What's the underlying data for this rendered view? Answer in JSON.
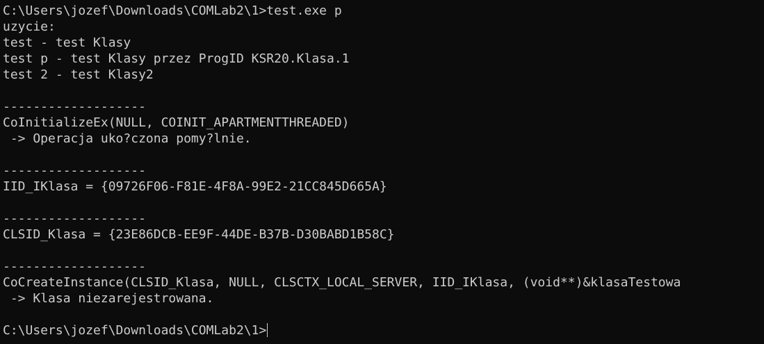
{
  "terminal": {
    "lines": [
      "C:\\Users\\jozef\\Downloads\\COMLab2\\1>test.exe p",
      "uzycie:",
      "test - test Klasy",
      "test p - test Klasy przez ProgID KSR20.Klasa.1",
      "test 2 - test Klasy2",
      "",
      "-------------------",
      "CoInitializeEx(NULL, COINIT_APARTMENTTHREADED)",
      " -> Operacja uko?czona pomy?lnie.",
      "",
      "-------------------",
      "IID_IKlasa = {09726F06-F81E-4F8A-99E2-21CC845D665A}",
      "",
      "-------------------",
      "CLSID_Klasa = {23E86DCB-EE9F-44DE-B37B-D30BABD1B58C}",
      "",
      "-------------------",
      "CoCreateInstance(CLSID_Klasa, NULL, CLSCTX_LOCAL_SERVER, IID_IKlasa, (void**)&klasaTestowa",
      " -> Klasa niezarejestrowana.",
      "",
      "C:\\Users\\jozef\\Downloads\\COMLab2\\1>"
    ]
  },
  "colors": {
    "background": "#0c0c0c",
    "text": "#cccccc"
  }
}
